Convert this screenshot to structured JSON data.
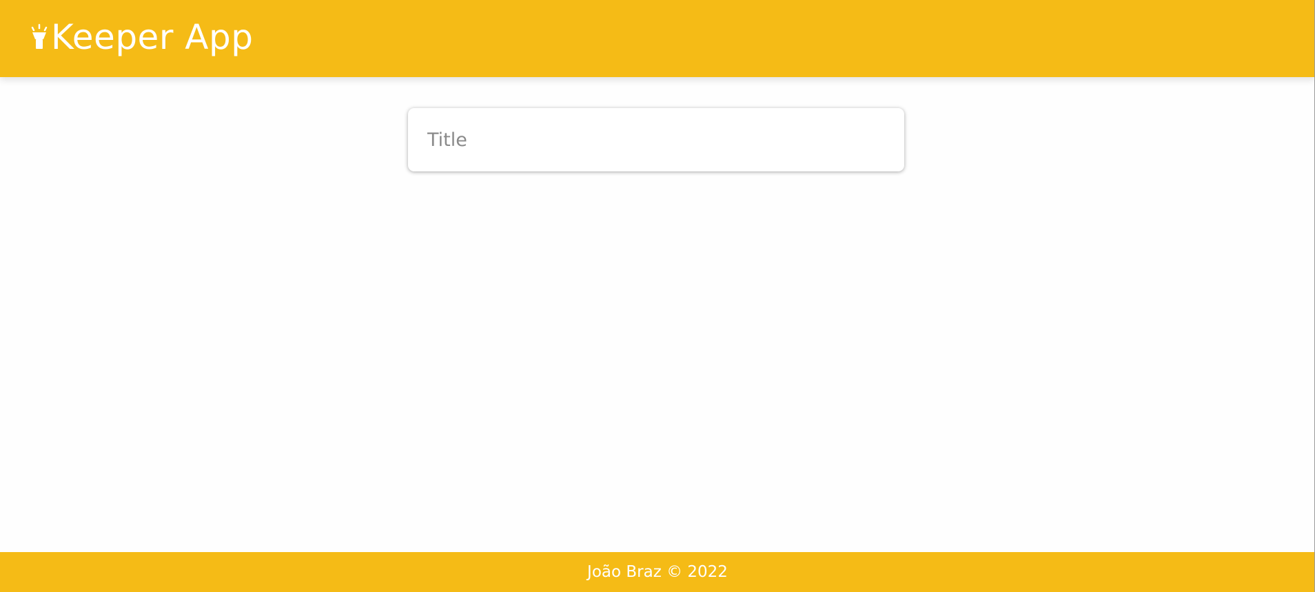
{
  "header": {
    "app_title": "Keeper App",
    "logo_icon": "flashlight-icon"
  },
  "note_form": {
    "title_placeholder": "Title",
    "title_value": ""
  },
  "footer": {
    "copyright": "João Braz © 2022"
  },
  "colors": {
    "brand": "#f5bb16",
    "background": "#fefefe",
    "text_on_brand": "#ffffff",
    "placeholder": "#8a8a8a"
  }
}
